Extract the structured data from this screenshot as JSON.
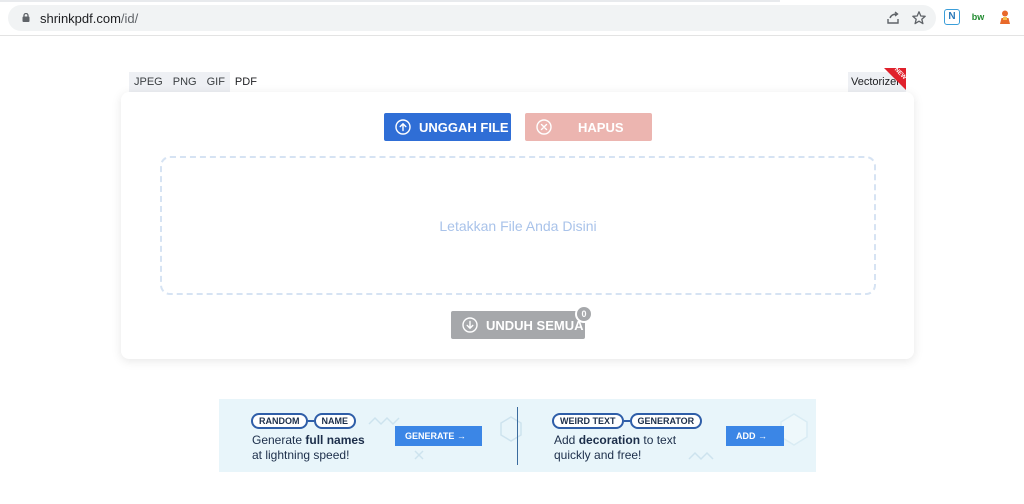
{
  "browser": {
    "url_host": "shrinkpdf.com",
    "url_path": "/id/"
  },
  "format_tabs": [
    {
      "label": "JPEG"
    },
    {
      "label": "PNG"
    },
    {
      "label": "GIF"
    },
    {
      "label": "PDF",
      "active": true
    }
  ],
  "vectorizer_tab": {
    "label": "Vectorizer!",
    "ribbon": "NEW"
  },
  "uploader": {
    "upload_label": "UNGGAH FILE",
    "delete_label": "HAPUS",
    "drop_text": "Letakkan File Anda Disini",
    "download_all_label": "UNDUH SEMUA",
    "file_count": "0"
  },
  "ad": {
    "left": {
      "pill1": "RANDOM",
      "pill2": "NAME",
      "line1_pre": "Generate ",
      "line1_bold": "full names",
      "line2": "at lightning speed!",
      "button": "GENERATE →"
    },
    "right": {
      "pill1": "WEIRD TEXT",
      "pill2": "GENERATOR",
      "line1_pre": "Add ",
      "line1_bold": "decoration",
      "line1_post": " to text",
      "line2": "quickly and free!",
      "button": "ADD →"
    }
  },
  "colors": {
    "primary": "#2f6ed6",
    "danger_light": "#ecb5b0",
    "disabled": "#a6a8ab",
    "arrow": "#e8a99f"
  },
  "extensions": [
    "N",
    "bw"
  ]
}
